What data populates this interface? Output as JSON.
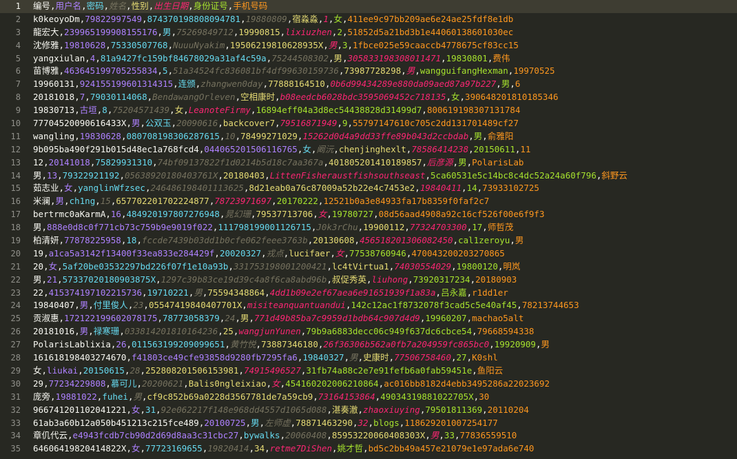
{
  "editor": {
    "lines": [
      {
        "n": "1",
        "fields": [
          "编号",
          "用户名",
          "密码",
          "姓名",
          "性别",
          "出生日期",
          "身份证号",
          "手机号码"
        ]
      },
      {
        "n": "2",
        "fields": [
          "k0keoyoDm",
          "79822997549",
          "874370198808094781",
          "19880809",
          "宿淼淼",
          "1",
          "女",
          "411ee9c97bb209ae6e24ae25fdf8e1db"
        ]
      },
      {
        "n": "3",
        "fields": [
          "龍宏大",
          "239965199908155176",
          "男",
          "75269849712",
          "19990815",
          "lixiuzhen",
          "2",
          "51852d5a21bd3b1e44060138601030ec"
        ]
      },
      {
        "n": "4",
        "fields": [
          "沈修雅",
          "19810628",
          "75330507768",
          "NuuuNyakim",
          "19506219810628935X",
          "男",
          "3",
          "1fbce025e59caaccb4778675cf83cc15"
        ]
      },
      {
        "n": "5",
        "fields": [
          "yangxiulan",
          "4",
          "81a9427fc159bf84678029a31af4c59a",
          "75244508302",
          "男",
          "305833198308011471",
          "19830801",
          "费伟"
        ]
      },
      {
        "n": "6",
        "fields": [
          "苗博雅",
          "463645199705255834",
          "5",
          "51a34524fc836081bf4df99630159736",
          "73987728298",
          "男",
          "wangguifangHexman",
          "19970525"
        ]
      },
      {
        "n": "7",
        "fields": [
          "19960131",
          "924155199601314315",
          "连颁",
          "zhangwen0day",
          "77888164510",
          "0b6d99434289e880da09aed87a97b227",
          "男",
          "6"
        ]
      },
      {
        "n": "8",
        "fields": [
          "20181018",
          "7",
          "79030114068",
          "BendawangOrleven",
          "空相康时",
          "b08eedcb6028bdc3595069452c718135",
          "女",
          "390648201810185346"
        ]
      },
      {
        "n": "9",
        "fields": [
          "19830713",
          "古垣",
          "8",
          "75204571439",
          "女",
          "LeanoteFirmy",
          "16894eff04a3d8ec54438828d31499d7",
          "800619198307131784"
        ]
      },
      {
        "n": "10",
        "fields": [
          "77704520090616433X",
          "男",
          "公双玉",
          "20090616",
          "backcover7",
          "79516871949",
          "9",
          "55797147610c705c2dd131701489cf27"
        ]
      },
      {
        "n": "11",
        "fields": [
          "wangling",
          "19830628",
          "080708198306287615",
          "10",
          "78499271029",
          "15262d0d4a9dd33ffe89b043d2ccbdab",
          "男",
          "俞雅阳"
        ]
      },
      {
        "n": "12",
        "fields": [
          "9b095ba490f291b015d48ec1a768fcd4",
          "044065201506116765",
          "女",
          "阚沅",
          "chenjinghexlt",
          "78586414238",
          "20150611",
          "11"
        ]
      },
      {
        "n": "13",
        "fields": [
          "12",
          "20141018",
          "75829931310",
          "74bf09137822f1d0214b5d18c7aa367a",
          "401805201410189857",
          "后彦源",
          "男",
          "PolarisLab"
        ]
      },
      {
        "n": "14",
        "fields": [
          "男",
          "13",
          "79322921192",
          "05638920180403761X",
          "20180403",
          "LittenFisheraustfishsouthseast",
          "5ca60531e5c14bc8c4dc52a24a60f796",
          "斜野云"
        ]
      },
      {
        "n": "15",
        "fields": [
          "茹志业",
          "女",
          "yanglinWfzsec",
          "246486198401113625",
          "8d21eab0a76c87009a52b22e4c7453e2",
          "19840411",
          "14",
          "73933102725"
        ]
      },
      {
        "n": "16",
        "fields": [
          "米澜",
          "男",
          "ch1ng",
          "15",
          "657702201702224877",
          "78723971697",
          "20170222",
          "12521b0a3e84933fa17b8359f0faf2c7"
        ]
      },
      {
        "n": "17",
        "fields": [
          "bertrmc0aKarmA",
          "16",
          "484920197807276948",
          "晁幻珊",
          "79537713706",
          "女",
          "19780727",
          "08d56aad4908a92c16cf526f00e6f9f3"
        ]
      },
      {
        "n": "18",
        "fields": [
          "男",
          "888e0d8c0f771cb73c759b9e9019f022",
          "111798199001126715",
          "J0k3rChu",
          "19900112",
          "77324703300",
          "17",
          "师哲茂"
        ]
      },
      {
        "n": "19",
        "fields": [
          "柏清妍",
          "77878225958",
          "18",
          "fccde7439b03dd1b0cfe062feee3763b",
          "20130608",
          "456518201306082450",
          "cal1zeroyu",
          "男"
        ]
      },
      {
        "n": "20",
        "fields": [
          "19",
          "a1ca5a3142f13400f33ea833e284429f",
          "20020327",
          "戎点",
          "lucifaer",
          "女",
          "77538760946",
          "470043200203270865"
        ]
      },
      {
        "n": "21",
        "fields": [
          "20",
          "女",
          "5af20be03532297bd226f07f1e10a93b",
          "331753198001200421",
          "lc4tVirtua1",
          "74030554029",
          "19800120",
          "明岚"
        ]
      },
      {
        "n": "22",
        "fields": [
          "男",
          "21",
          "57337020180903875X",
          "1297c39b83ce19d39c4a8f6ca8abd96b",
          "叔促秀英",
          "liuhong",
          "73920317234",
          "20180903"
        ]
      },
      {
        "n": "23",
        "fields": [
          "22",
          "415374197102215736",
          "19710221",
          "男",
          "75594348864",
          "4dd1b09e2ef67aea6e91651939f1a83a",
          "吕永嘉",
          "r1dd1er"
        ]
      },
      {
        "n": "24",
        "fields": [
          "19840407",
          "男",
          "付里俊人",
          "23",
          "05547419840407701X",
          "misiteanquantuandui",
          "142c12ac1f8732078f3cad5c5e40af45",
          "78213744653"
        ]
      },
      {
        "n": "25",
        "fields": [
          "贡淑惠",
          "172122199602078175",
          "78773058379",
          "24",
          "男",
          "771d49b85ba7c9959d1bdb64c907d4d9",
          "19960207",
          "machao5alt"
        ]
      },
      {
        "n": "26",
        "fields": [
          "20181016",
          "男",
          "禄寒珊",
          "033814201810164236",
          "25",
          "wangjunYunen",
          "79b9a6883decc06c949f637dc6cbce54",
          "79668594338"
        ]
      },
      {
        "n": "27",
        "fields": [
          "PolarisLablixia",
          "26",
          "011563199209099651",
          "黄竹悦",
          "73887346180",
          "26f36306b562a0fb7a204959fc865bc0",
          "19920909",
          "男"
        ]
      },
      {
        "n": "28",
        "fields": [
          "161618198403274670",
          "f41803ce49cfe93858d9280fb7295fa6",
          "19840327",
          "男",
          "史康时",
          "77506758460",
          "27",
          "K0shl"
        ]
      },
      {
        "n": "29",
        "fields": [
          "女",
          "liukai",
          "20150615",
          "28",
          "252808201506153981",
          "74915496527",
          "31fb74a88c2e7e91fefb6a0fab59451e",
          "鱼阳云"
        ]
      },
      {
        "n": "30",
        "fields": [
          "29",
          "77234229808",
          "慕可儿",
          "20200621",
          "Balis0ngleixiao",
          "女",
          "454160202006210864",
          "ac016bb8182d4ebb3495286a22023692"
        ]
      },
      {
        "n": "31",
        "fields": [
          "庞旁",
          "19881022",
          "fuhei",
          "男",
          "cf9c852b69a0228d3567781de7a59cb9",
          "73164153864",
          "49034319881022705X",
          "30"
        ]
      },
      {
        "n": "32",
        "fields": [
          "966741201102041221",
          "女",
          "31",
          "92e062217f148e968dd4557d1065d088",
          "湛奏澈",
          "zhaoxiuying",
          "79501811369",
          "20110204"
        ]
      },
      {
        "n": "33",
        "fields": [
          "61ab3a60b12a050b451213c215fce489",
          "20100725",
          "男",
          "左师虚",
          "78871463290",
          "32",
          "blogs",
          "118629201007254177"
        ]
      },
      {
        "n": "34",
        "fields": [
          "章仉代云",
          "e4943fcdb7cb90d2d69d8aa3c31cbc27",
          "bywalks",
          "20060408",
          "85953220060408303X",
          "男",
          "33",
          "77836559510"
        ]
      },
      {
        "n": "35",
        "fields": [
          "64606419820414822X",
          "女",
          "77723169655",
          "19820414",
          "34",
          "retme7DiShen",
          "姚才哲",
          "bd5c2bb49a457e21079e1e97ada6e740"
        ]
      }
    ],
    "column_colors": [
      "#f8f8f2",
      "#ae81ff",
      "#66d9ef",
      "#75715e",
      "#e6db74",
      "#f92672",
      "#a6e22e",
      "#fd971f"
    ]
  }
}
